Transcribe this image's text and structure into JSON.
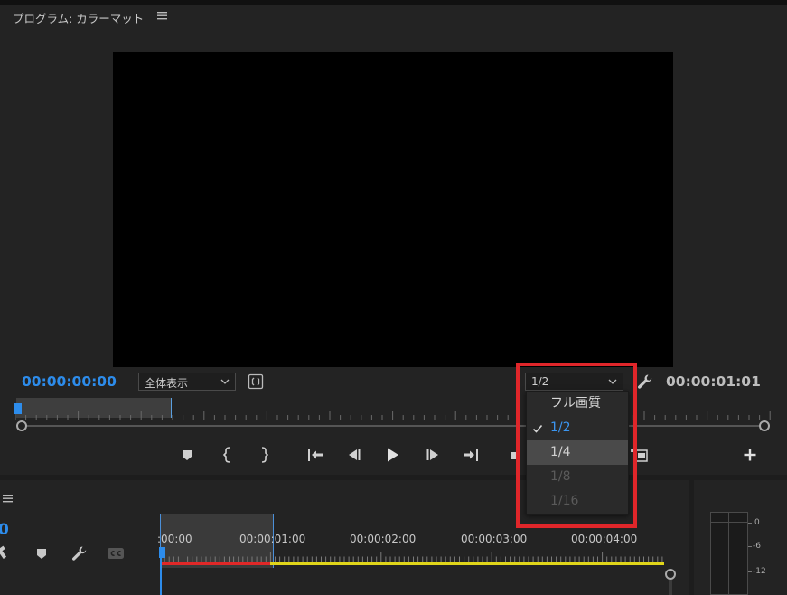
{
  "program_monitor": {
    "title": "プログラム: カラーマット",
    "current_timecode": "00:00:00:00",
    "duration_timecode": "00:00:01:01",
    "fit_select": {
      "value": "全体表示"
    },
    "resolution_select": {
      "value": "1/2"
    }
  },
  "resolution_menu": {
    "items": [
      {
        "label": "フル画質",
        "state": "enabled"
      },
      {
        "label": "1/2",
        "state": "checked"
      },
      {
        "label": "1/4",
        "state": "hover"
      },
      {
        "label": "1/8",
        "state": "disabled"
      },
      {
        "label": "1/16",
        "state": "disabled"
      }
    ]
  },
  "timeline": {
    "timecode_fragment": "0",
    "ruler_labels": [
      ":00:00",
      "00:00:01:00",
      "00:00:02:00",
      "00:00:03:00",
      "00:00:04:00"
    ],
    "tools": [
      "snap-icon",
      "marker-icon",
      "wrench-icon",
      "cc-icon"
    ]
  },
  "audio_meter": {
    "labels": [
      "0",
      "-6",
      "-12"
    ]
  },
  "colors": {
    "accent_blue": "#2d8ceb",
    "highlight_red": "#e0262a",
    "render_red": "#e02828",
    "render_yellow": "#e0d51a"
  }
}
